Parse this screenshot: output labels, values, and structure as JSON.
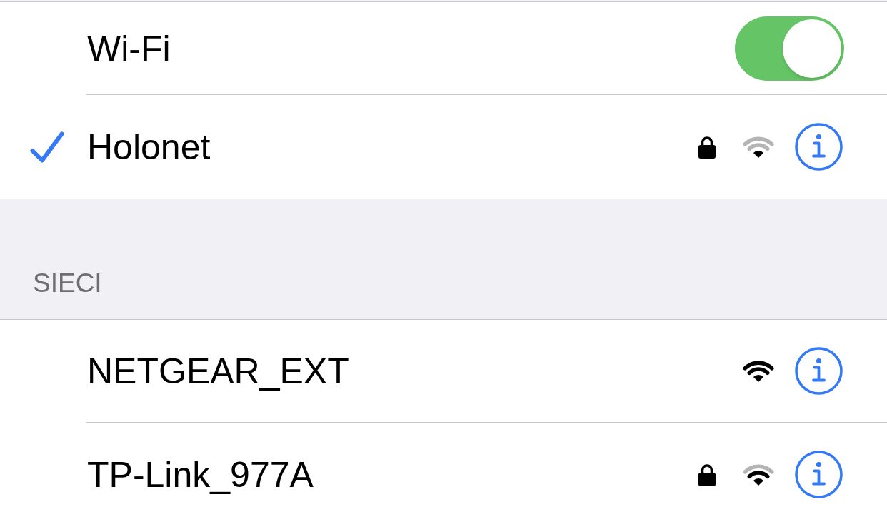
{
  "wifi": {
    "label": "Wi-Fi",
    "on": true
  },
  "current_network": {
    "name": "Holonet",
    "kind": "weak",
    "connected": true,
    "secured": true
  },
  "networks_section": {
    "header": "SIECI",
    "networks": [
      {
        "name": "NETGEAR_EXT",
        "kind": "strong",
        "connected": false,
        "secured": false
      },
      {
        "name": "TP-Link_977A",
        "kind": "medium",
        "connected": false,
        "secured": true
      }
    ]
  }
}
